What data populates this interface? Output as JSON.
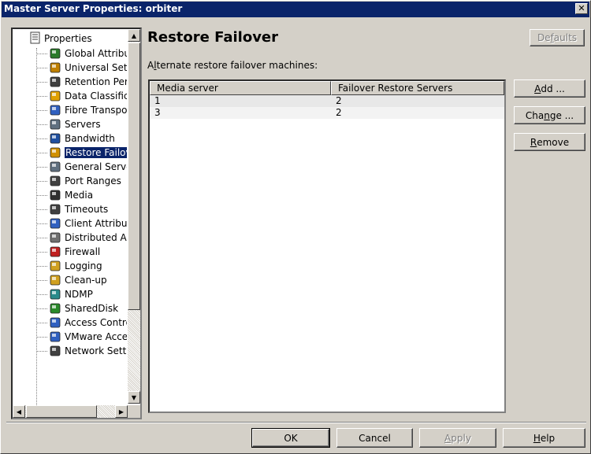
{
  "window": {
    "title": "Master Server Properties: orbiter",
    "close_glyph": "✕"
  },
  "tree": {
    "root_label": "Properties",
    "items": [
      {
        "label": "Global Attribut",
        "icon": "globe-icon",
        "color": "#2a7a2a"
      },
      {
        "label": "Universal Setti",
        "icon": "universal-settings-icon",
        "color": "#c08000"
      },
      {
        "label": "Retention Peri",
        "icon": "retention-icon",
        "color": "#404040"
      },
      {
        "label": "Data Classifica",
        "icon": "data-classification-icon",
        "color": "#e0a000"
      },
      {
        "label": "Fibre Transpor",
        "icon": "fibre-transport-icon",
        "color": "#3060c0"
      },
      {
        "label": "Servers",
        "icon": "servers-icon",
        "color": "#607080"
      },
      {
        "label": "Bandwidth",
        "icon": "bandwidth-icon",
        "color": "#2050a0"
      },
      {
        "label": "Restore Failov",
        "icon": "restore-failover-icon",
        "color": "#d09000"
      },
      {
        "label": "General Server",
        "icon": "general-server-icon",
        "color": "#607080"
      },
      {
        "label": "Port Ranges",
        "icon": "port-ranges-icon",
        "color": "#404040"
      },
      {
        "label": "Media",
        "icon": "media-icon",
        "color": "#303030"
      },
      {
        "label": "Timeouts",
        "icon": "timeouts-icon",
        "color": "#404040"
      },
      {
        "label": "Client Attribute",
        "icon": "client-attributes-icon",
        "color": "#3060c0"
      },
      {
        "label": "Distributed Ap",
        "icon": "distributed-app-icon",
        "color": "#707070"
      },
      {
        "label": "Firewall",
        "icon": "firewall-icon",
        "color": "#c02020"
      },
      {
        "label": "Logging",
        "icon": "logging-icon",
        "color": "#d0a020"
      },
      {
        "label": "Clean-up",
        "icon": "clean-up-icon",
        "color": "#d0a020"
      },
      {
        "label": "NDMP",
        "icon": "ndmp-icon",
        "color": "#2a8a8a"
      },
      {
        "label": "SharedDisk",
        "icon": "shared-disk-icon",
        "color": "#2a8a2a"
      },
      {
        "label": "Access Contro",
        "icon": "access-control-icon",
        "color": "#3060c0"
      },
      {
        "label": "VMware Acces",
        "icon": "vmware-access-icon",
        "color": "#3060c0"
      },
      {
        "label": "Network Settir",
        "icon": "network-settings-icon",
        "color": "#404040"
      }
    ],
    "selected_index": 7
  },
  "content": {
    "heading": "Restore Failover",
    "subheading_pre": "A",
    "subheading_u": "l",
    "subheading_post": "ternate restore failover machines:",
    "defaults_pre": "De",
    "defaults_u": "f",
    "defaults_post": "aults",
    "table": {
      "columns": [
        "Media server",
        "Failover Restore Servers"
      ],
      "rows": [
        [
          "1",
          "2"
        ],
        [
          "3",
          "2"
        ]
      ]
    },
    "buttons": {
      "add_u": "A",
      "add_post": "dd ...",
      "change_pre": "Cha",
      "change_u": "n",
      "change_post": "ge ...",
      "remove_u": "R",
      "remove_post": "emove"
    }
  },
  "footer": {
    "ok": "OK",
    "cancel": "Cancel",
    "apply_u": "A",
    "apply_post": "pply",
    "help_u": "H",
    "help_post": "elp"
  },
  "colors": {
    "titlebar": "#0a246a",
    "selection": "#0a246a",
    "dialog_face": "#d4d0c8"
  }
}
